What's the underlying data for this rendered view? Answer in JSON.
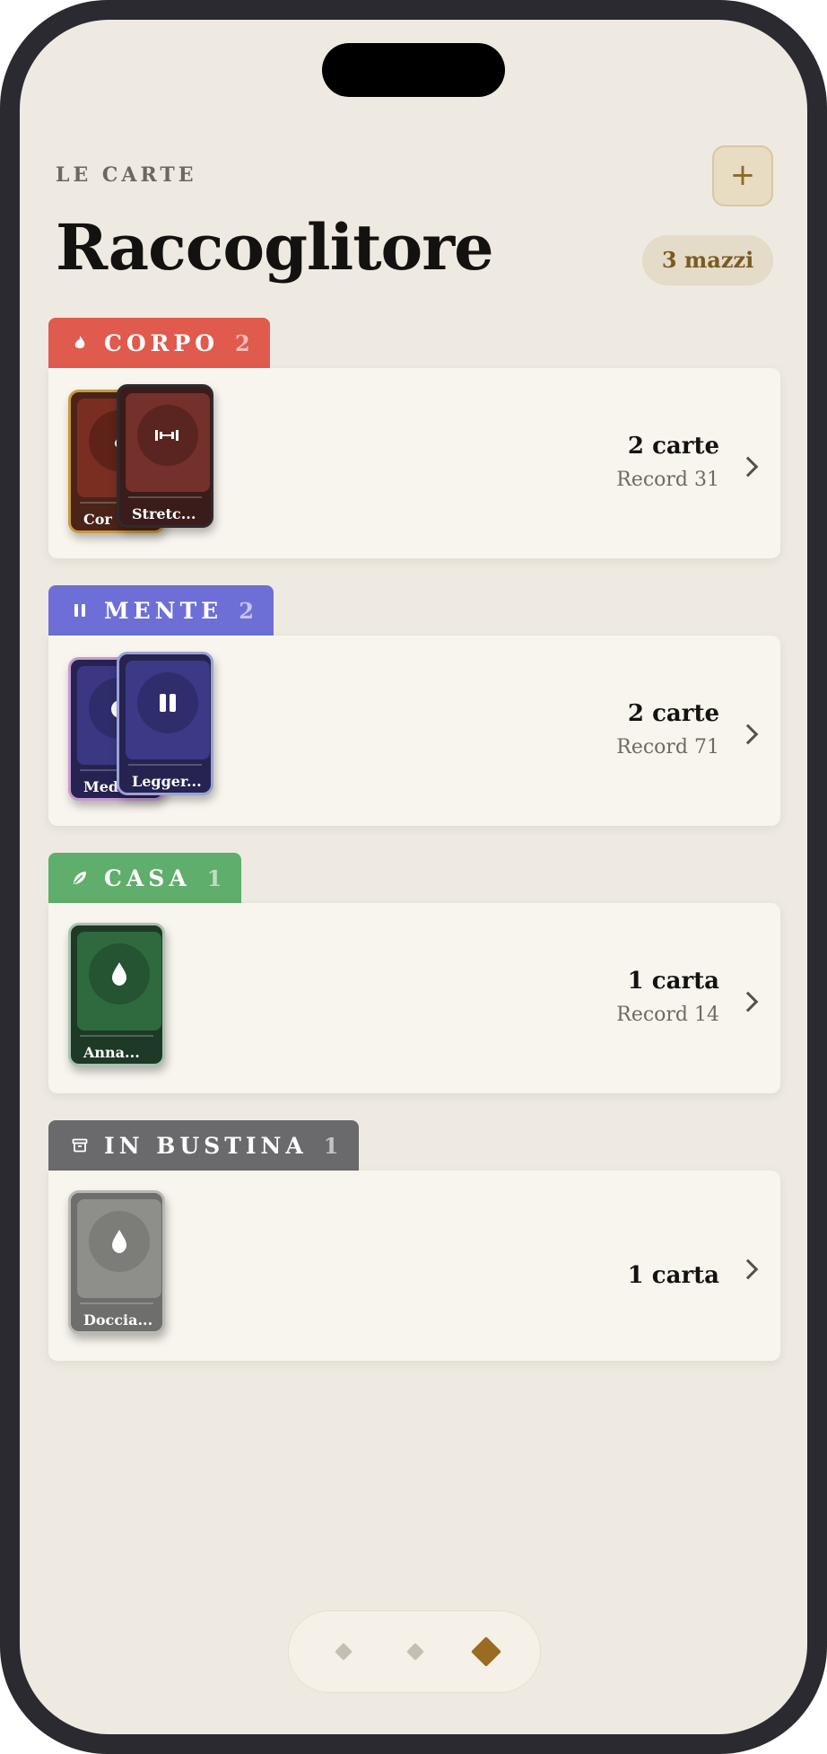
{
  "header": {
    "eyebrow": "LE CARTE",
    "title": "Raccoglitore",
    "add_icon": "+",
    "deck_count": "3 mazzi"
  },
  "sections": [
    {
      "label": "CORPO",
      "count": "2",
      "color": "#e05a4e",
      "icon": "flame-icon",
      "summary": "2 carte",
      "record": "Record 31",
      "cards": [
        {
          "label": "Cor",
          "icon": "flame-icon"
        },
        {
          "label": "Stretc...",
          "icon": "dumbbell-icon"
        }
      ]
    },
    {
      "label": "MENTE",
      "count": "2",
      "color": "#6e6fd6",
      "icon": "pause-icon",
      "summary": "2 carte",
      "record": "Record 71",
      "cards": [
        {
          "label": "Med",
          "icon": "moon-icon"
        },
        {
          "label": "Legger...",
          "icon": "pause-icon"
        }
      ]
    },
    {
      "label": "CASA",
      "count": "1",
      "color": "#5fae6b",
      "icon": "leaf-icon",
      "summary": "1 carta",
      "record": "Record 14",
      "cards": [
        {
          "label": "Anna...",
          "icon": "drop-icon"
        }
      ]
    },
    {
      "label": "IN BUSTINA",
      "count": "1",
      "color": "#6a6a6c",
      "icon": "archive-icon",
      "summary": "1 carta",
      "cards": [
        {
          "label": "Doccia...",
          "icon": "drop-icon"
        }
      ]
    }
  ],
  "pager": {
    "pages": 3,
    "active_page": 3
  },
  "colors": {
    "background": "#eeeae2",
    "card": "#f8f5ee",
    "accent": "#9a6c22"
  }
}
